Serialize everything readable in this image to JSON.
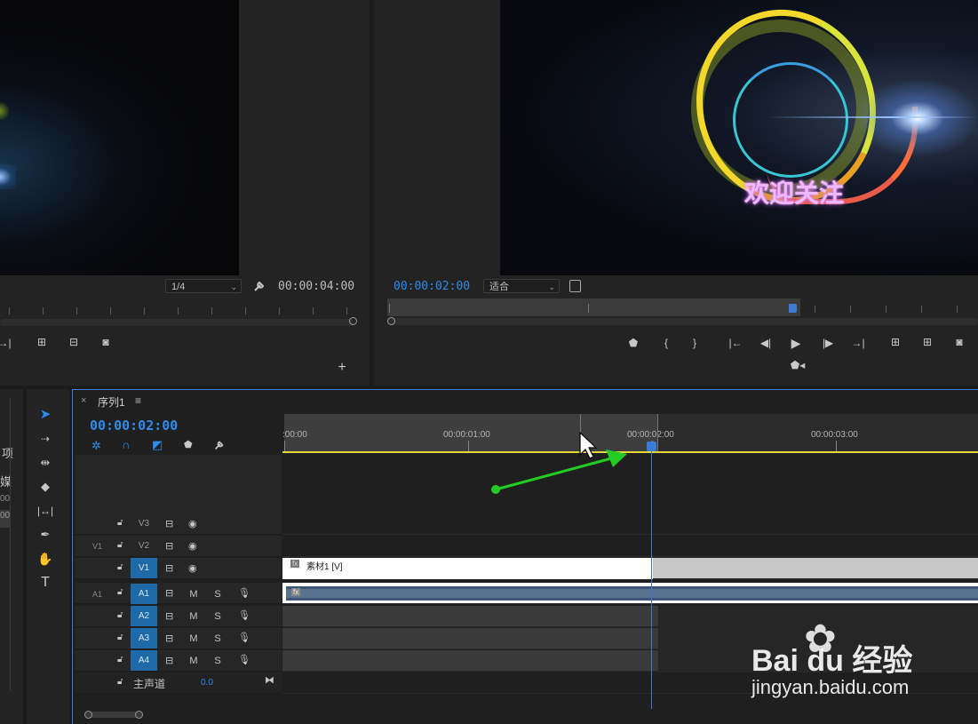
{
  "source_monitor": {
    "resolution": "1/4",
    "duration": "00:00:04:00"
  },
  "program_monitor": {
    "timecode": "00:00:02:00",
    "fit": "适合",
    "overlay_text": "欢迎关注"
  },
  "left_panel": {
    "text1": "项",
    "text2": "媒",
    "text3": "00",
    "text4": "00"
  },
  "sequence": {
    "close": "×",
    "name": "序列1",
    "menu": "≡",
    "timecode": "00:00:02:00",
    "ruler_labels": [
      ":00:00",
      "00:00:01:00",
      "00:00:02:00",
      "00:00:03:00"
    ],
    "video_tracks": [
      {
        "name": "V3",
        "src": ""
      },
      {
        "name": "V2",
        "src": "V1"
      },
      {
        "name": "V1",
        "src": ""
      }
    ],
    "audio_tracks": [
      {
        "name": "A1",
        "src": "A1"
      },
      {
        "name": "A2",
        "src": ""
      },
      {
        "name": "A3",
        "src": ""
      },
      {
        "name": "A4",
        "src": ""
      }
    ],
    "master": {
      "label": "主声道",
      "value": "0.0"
    },
    "clip_label": "素材1 [V]",
    "fx_badge": "fx",
    "mute": "M",
    "solo": "S"
  },
  "watermark": {
    "brand": "Bai du 经验",
    "url": "jingyan.baidu.com"
  },
  "colors": {
    "accent": "#2d8ceb",
    "playhead": "#3a7bd5",
    "work_area": "#e5d83a",
    "arrow": "#22cc22"
  }
}
